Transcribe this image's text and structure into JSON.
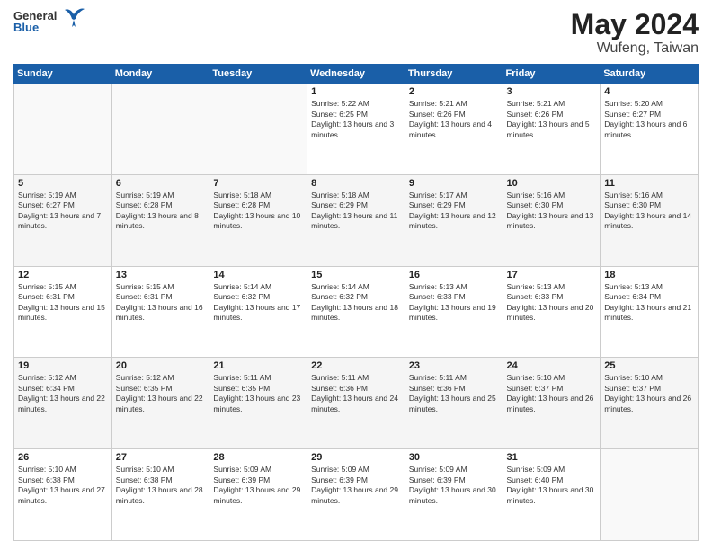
{
  "header": {
    "logo_general": "General",
    "logo_blue": "Blue",
    "month_year": "May 2024",
    "location": "Wufeng, Taiwan"
  },
  "days_of_week": [
    "Sunday",
    "Monday",
    "Tuesday",
    "Wednesday",
    "Thursday",
    "Friday",
    "Saturday"
  ],
  "weeks": [
    [
      {
        "day": "",
        "text": ""
      },
      {
        "day": "",
        "text": ""
      },
      {
        "day": "",
        "text": ""
      },
      {
        "day": "1",
        "text": "Sunrise: 5:22 AM\nSunset: 6:25 PM\nDaylight: 13 hours and 3 minutes."
      },
      {
        "day": "2",
        "text": "Sunrise: 5:21 AM\nSunset: 6:26 PM\nDaylight: 13 hours and 4 minutes."
      },
      {
        "day": "3",
        "text": "Sunrise: 5:21 AM\nSunset: 6:26 PM\nDaylight: 13 hours and 5 minutes."
      },
      {
        "day": "4",
        "text": "Sunrise: 5:20 AM\nSunset: 6:27 PM\nDaylight: 13 hours and 6 minutes."
      }
    ],
    [
      {
        "day": "5",
        "text": "Sunrise: 5:19 AM\nSunset: 6:27 PM\nDaylight: 13 hours and 7 minutes."
      },
      {
        "day": "6",
        "text": "Sunrise: 5:19 AM\nSunset: 6:28 PM\nDaylight: 13 hours and 8 minutes."
      },
      {
        "day": "7",
        "text": "Sunrise: 5:18 AM\nSunset: 6:28 PM\nDaylight: 13 hours and 10 minutes."
      },
      {
        "day": "8",
        "text": "Sunrise: 5:18 AM\nSunset: 6:29 PM\nDaylight: 13 hours and 11 minutes."
      },
      {
        "day": "9",
        "text": "Sunrise: 5:17 AM\nSunset: 6:29 PM\nDaylight: 13 hours and 12 minutes."
      },
      {
        "day": "10",
        "text": "Sunrise: 5:16 AM\nSunset: 6:30 PM\nDaylight: 13 hours and 13 minutes."
      },
      {
        "day": "11",
        "text": "Sunrise: 5:16 AM\nSunset: 6:30 PM\nDaylight: 13 hours and 14 minutes."
      }
    ],
    [
      {
        "day": "12",
        "text": "Sunrise: 5:15 AM\nSunset: 6:31 PM\nDaylight: 13 hours and 15 minutes."
      },
      {
        "day": "13",
        "text": "Sunrise: 5:15 AM\nSunset: 6:31 PM\nDaylight: 13 hours and 16 minutes."
      },
      {
        "day": "14",
        "text": "Sunrise: 5:14 AM\nSunset: 6:32 PM\nDaylight: 13 hours and 17 minutes."
      },
      {
        "day": "15",
        "text": "Sunrise: 5:14 AM\nSunset: 6:32 PM\nDaylight: 13 hours and 18 minutes."
      },
      {
        "day": "16",
        "text": "Sunrise: 5:13 AM\nSunset: 6:33 PM\nDaylight: 13 hours and 19 minutes."
      },
      {
        "day": "17",
        "text": "Sunrise: 5:13 AM\nSunset: 6:33 PM\nDaylight: 13 hours and 20 minutes."
      },
      {
        "day": "18",
        "text": "Sunrise: 5:13 AM\nSunset: 6:34 PM\nDaylight: 13 hours and 21 minutes."
      }
    ],
    [
      {
        "day": "19",
        "text": "Sunrise: 5:12 AM\nSunset: 6:34 PM\nDaylight: 13 hours and 22 minutes."
      },
      {
        "day": "20",
        "text": "Sunrise: 5:12 AM\nSunset: 6:35 PM\nDaylight: 13 hours and 22 minutes."
      },
      {
        "day": "21",
        "text": "Sunrise: 5:11 AM\nSunset: 6:35 PM\nDaylight: 13 hours and 23 minutes."
      },
      {
        "day": "22",
        "text": "Sunrise: 5:11 AM\nSunset: 6:36 PM\nDaylight: 13 hours and 24 minutes."
      },
      {
        "day": "23",
        "text": "Sunrise: 5:11 AM\nSunset: 6:36 PM\nDaylight: 13 hours and 25 minutes."
      },
      {
        "day": "24",
        "text": "Sunrise: 5:10 AM\nSunset: 6:37 PM\nDaylight: 13 hours and 26 minutes."
      },
      {
        "day": "25",
        "text": "Sunrise: 5:10 AM\nSunset: 6:37 PM\nDaylight: 13 hours and 26 minutes."
      }
    ],
    [
      {
        "day": "26",
        "text": "Sunrise: 5:10 AM\nSunset: 6:38 PM\nDaylight: 13 hours and 27 minutes."
      },
      {
        "day": "27",
        "text": "Sunrise: 5:10 AM\nSunset: 6:38 PM\nDaylight: 13 hours and 28 minutes."
      },
      {
        "day": "28",
        "text": "Sunrise: 5:09 AM\nSunset: 6:39 PM\nDaylight: 13 hours and 29 minutes."
      },
      {
        "day": "29",
        "text": "Sunrise: 5:09 AM\nSunset: 6:39 PM\nDaylight: 13 hours and 29 minutes."
      },
      {
        "day": "30",
        "text": "Sunrise: 5:09 AM\nSunset: 6:39 PM\nDaylight: 13 hours and 30 minutes."
      },
      {
        "day": "31",
        "text": "Sunrise: 5:09 AM\nSunset: 6:40 PM\nDaylight: 13 hours and 30 minutes."
      },
      {
        "day": "",
        "text": ""
      }
    ]
  ]
}
